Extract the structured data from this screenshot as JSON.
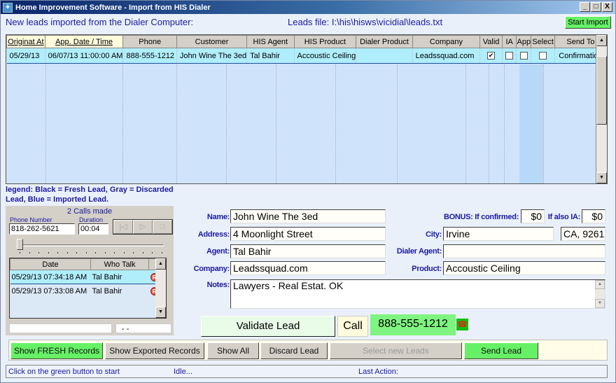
{
  "window": {
    "title": "Home Improvement Software - Import from HIS Dialer",
    "controls": [
      "_",
      "□",
      "X"
    ]
  },
  "header": {
    "subtitle": "New leads imported from the Dialer Computer:",
    "leads_file": "Leads file: I:\\his\\hisws\\vicidial\\leads.txt",
    "start_import_label": "Start Import"
  },
  "grid": {
    "columns": [
      "Originat At",
      "App. Date / Time",
      "Phone",
      "Customer",
      "HIS Agent",
      "HIS Product",
      "Dialer Product",
      "Company",
      "Valid",
      "IA",
      "App",
      "Select",
      "Send To"
    ],
    "rows": [
      {
        "originat_at": "05/29/13",
        "app_datetime": "06/07/13 11:00:00 AM",
        "phone": "888-555-1212",
        "customer": "John Wine The 3ed",
        "his_agent": "Tal Bahir",
        "his_product": "Accoustic Ceiling",
        "dialer_product": "",
        "company": "Leadssquad.com",
        "valid": true,
        "ia": false,
        "app": false,
        "select": false,
        "send_to": "Confirmation"
      }
    ]
  },
  "legend": "legend: Black = Fresh Lead, Gray = Discarded Lead, Blue = Imported Lead.",
  "call_panel": {
    "calls_made": "2 Calls made",
    "phone_number_label": "Phone Number",
    "phone_number": "818-262-5621",
    "duration_label": "Duration",
    "duration": "00:04",
    "media_buttons": [
      "|◁",
      "▷",
      "□"
    ],
    "list_columns": [
      "Date",
      "Who Talk",
      ""
    ],
    "calls": [
      {
        "date": "05/29/13 07:34:18 AM",
        "who": "Tal Bahir",
        "rec": "R"
      },
      {
        "date": "05/29/13 07:33:08 AM",
        "who": "Tal Bahir",
        "rec": "R"
      }
    ],
    "bottom_left": "",
    "bottom_right": "-  -"
  },
  "form": {
    "name_label": "Name:",
    "name": "John Wine The 3ed",
    "address_label": "Address:",
    "address": "4 Moonlight Street",
    "agent_label": "Agent:",
    "agent": "Tal Bahir",
    "company_label": "Company:",
    "company": "Leadssquad.com",
    "notes_label": "Notes:",
    "notes": "Lawyers - Real Estat. OK",
    "bonus_label": "BONUS: If confirmed:",
    "bonus": "$0",
    "also_ia_label": "If also IA:",
    "also_ia": "$0",
    "city_label": "City:",
    "city": "Irvine",
    "state_zip": "CA, 9261",
    "dialer_agent_label": "Dialer Agent:",
    "dialer_agent": "",
    "product_label": "Product:",
    "product": "Accoustic Ceiling"
  },
  "actions": {
    "validate_label": "Validate Lead",
    "call_label": "Call",
    "call_number": "888-555-1212",
    "phone_icon": "☎"
  },
  "buttons": {
    "show_fresh": "Show FRESH Records",
    "show_exported": "Show Exported Records",
    "show_all": "Show All",
    "discard": "Discard Lead",
    "select_new": "Select new Leads",
    "send": "Send Lead"
  },
  "status": {
    "hint": "Click on the green button to start",
    "state": "Idle...",
    "last_action": "Last Action:"
  },
  "colors": {
    "accent_green": "#66f066",
    "label_blue": "#1a1aa0",
    "row_highlight": "#b0eefc"
  }
}
